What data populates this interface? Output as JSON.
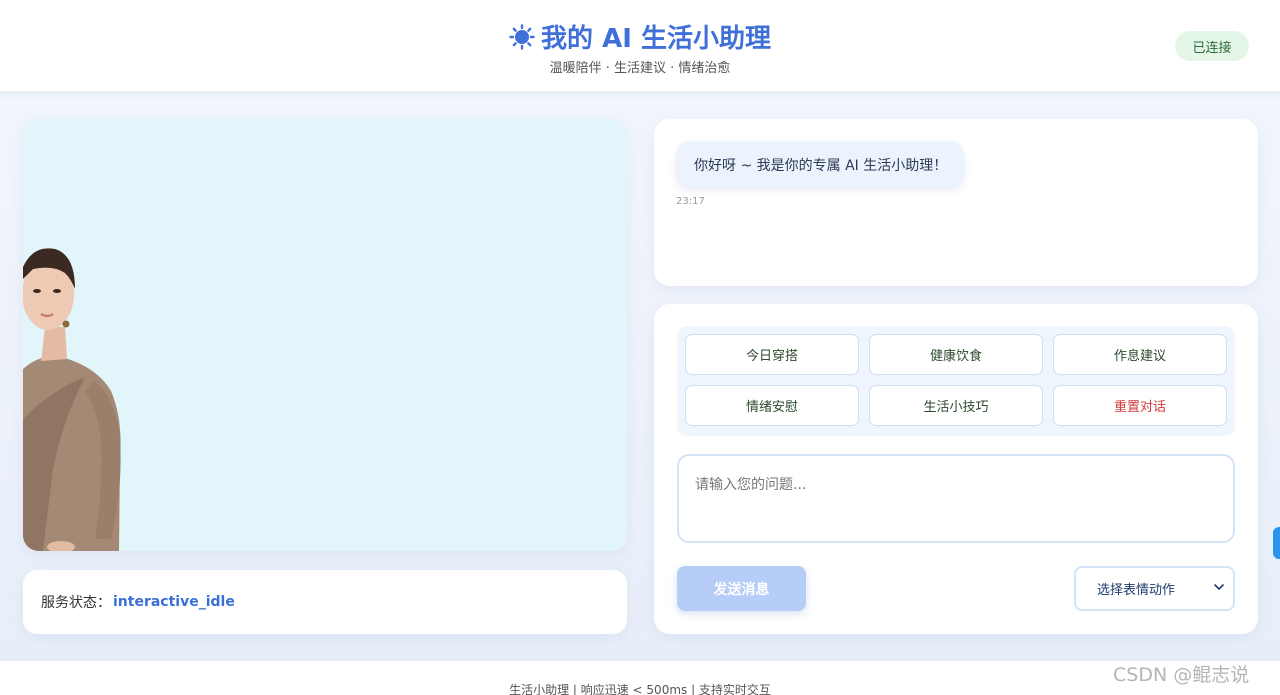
{
  "header": {
    "title": "我的 AI 生活小助理",
    "subtitle": "温暖陪伴 · 生活建议 · 情绪治愈",
    "status_badge": "已连接"
  },
  "status": {
    "label": "服务状态：",
    "value": "interactive_idle"
  },
  "chat": {
    "messages": [
      {
        "text": "你好呀 ~ 我是你的专属 AI 生活小助理！",
        "time": "23:17"
      }
    ]
  },
  "quick_actions": [
    {
      "label": "今日穿搭"
    },
    {
      "label": "健康饮食"
    },
    {
      "label": "作息建议"
    },
    {
      "label": "情绪安慰"
    },
    {
      "label": "生活小技巧"
    },
    {
      "label": "重置对话"
    }
  ],
  "input": {
    "placeholder": "请输入您的问题..."
  },
  "controls": {
    "send_label": "发送消息",
    "emotion_select": "选择表情动作"
  },
  "footer": {
    "text": "生活小助理 | 响应迅速 < 500ms | 支持实时交互"
  },
  "watermark": "CSDN @鲲志说",
  "colors": {
    "brand": "#3f6fd8",
    "connected_bg": "#e3f6e8",
    "danger": "#d23b3b",
    "avatar_bg": "#e2f5fa"
  }
}
